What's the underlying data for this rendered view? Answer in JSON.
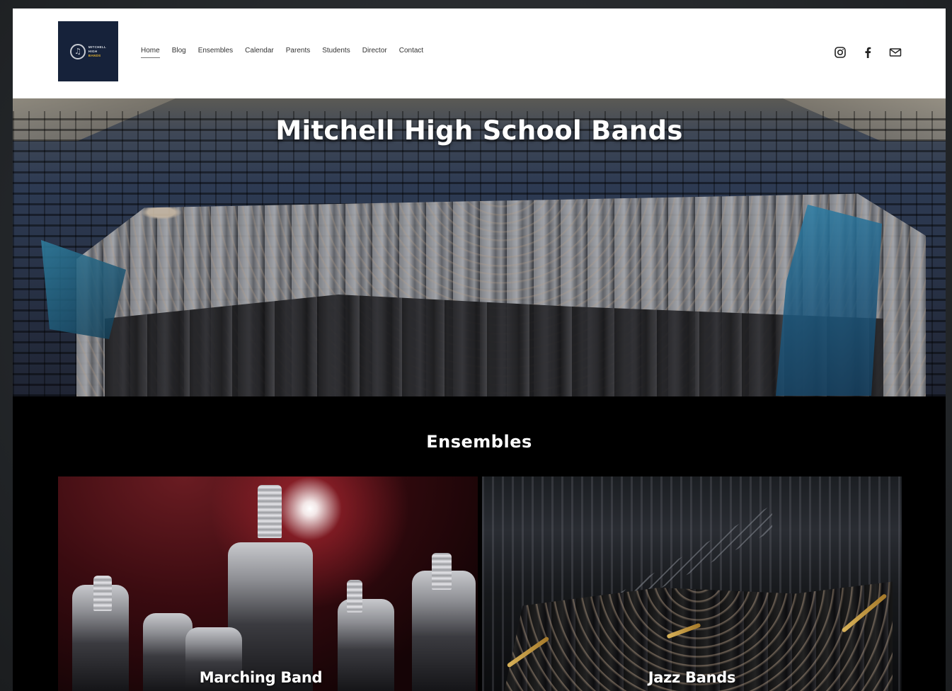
{
  "logo": {
    "line1": "MITCHELL",
    "line2": "HIGH",
    "line3": "BANDS"
  },
  "nav": {
    "items": [
      {
        "label": "Home",
        "active": true
      },
      {
        "label": "Blog"
      },
      {
        "label": "Ensembles"
      },
      {
        "label": "Calendar"
      },
      {
        "label": "Parents"
      },
      {
        "label": "Students"
      },
      {
        "label": "Director"
      },
      {
        "label": "Contact"
      }
    ]
  },
  "social": {
    "icons": [
      "instagram-icon",
      "facebook-icon",
      "email-icon"
    ]
  },
  "hero": {
    "title": "Mitchell High School Bands"
  },
  "ensembles": {
    "heading": "Ensembles",
    "cards": [
      {
        "label": "Marching Band"
      },
      {
        "label": "Jazz Bands"
      }
    ]
  },
  "colors": {
    "logo_bg": "#16223a",
    "logo_accent": "#e8b530",
    "page_bg": "#000000",
    "header_bg": "#ffffff"
  }
}
